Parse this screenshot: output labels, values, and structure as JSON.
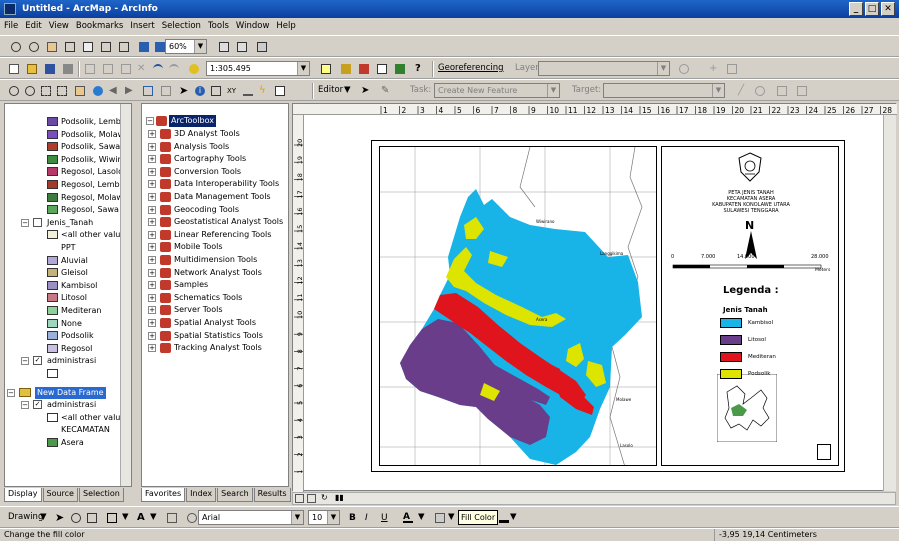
{
  "window": {
    "title": "Untitled - ArcMap - ArcInfo"
  },
  "menu": [
    "File",
    "Edit",
    "View",
    "Bookmarks",
    "Insert",
    "Selection",
    "Tools",
    "Window",
    "Help"
  ],
  "toolbar": {
    "zoom": "60%",
    "scale": "1:305.495",
    "georef": "Georeferencing",
    "layer": "Layer:",
    "editor": "Editor",
    "task": "Task:",
    "task_value": "Create New Feature",
    "target": "Target:"
  },
  "toc": {
    "items_top": [
      {
        "label": "Podsolik, Lembo",
        "color": "#6a4aa5"
      },
      {
        "label": "Podsolik, Molaw",
        "color": "#7b4dc0"
      },
      {
        "label": "Podsolik, Sawa",
        "color": "#b03c2c"
      },
      {
        "label": "Podsolik, Wiwir",
        "color": "#3e8a3e"
      },
      {
        "label": "Regosol, Lasolo",
        "color": "#b43a6a"
      },
      {
        "label": "Regosol, Lembo",
        "color": "#a43b2a"
      },
      {
        "label": "Regosol, Molaw",
        "color": "#3f7a3f"
      },
      {
        "label": "Regosol, Sawa",
        "color": "#5aa65a"
      }
    ],
    "jenis_tanah": {
      "layer": "Jenis_Tanah",
      "all_other": "<all other value:",
      "field": "PPT",
      "classes": [
        {
          "label": "Aluvial",
          "color": "#b0a8d8"
        },
        {
          "label": "Gleisol",
          "color": "#c5b27a"
        },
        {
          "label": "Kambisol",
          "color": "#9a8fc2"
        },
        {
          "label": "Litosol",
          "color": "#c77a86"
        },
        {
          "label": "Mediteran",
          "color": "#8fcf9a"
        },
        {
          "label": "None",
          "color": "#9fd6c0"
        },
        {
          "label": "Podsolik",
          "color": "#9ab0d8"
        },
        {
          "label": "Regosol",
          "color": "#c8c0e0"
        }
      ]
    },
    "administrasi1": "administrasi",
    "frame2": "New Data Frame",
    "administrasi2": "administrasi",
    "all_other2": "<all other value:",
    "kecamatan": "KECAMATAN",
    "asera": "Asera",
    "tabs": [
      "Display",
      "Source",
      "Selection"
    ]
  },
  "toolbox": {
    "root": "ArcToolbox",
    "items": [
      "3D Analyst Tools",
      "Analysis Tools",
      "Cartography Tools",
      "Conversion Tools",
      "Data Interoperability Tools",
      "Data Management Tools",
      "Geocoding Tools",
      "Geostatistical Analyst Tools",
      "Linear Referencing Tools",
      "Mobile Tools",
      "Multidimension Tools",
      "Network Analyst Tools",
      "Samples",
      "Schematics Tools",
      "Server Tools",
      "Spatial Analyst Tools",
      "Spatial Statistics Tools",
      "Tracking Analyst Tools"
    ],
    "tabs": [
      "Favorites",
      "Index",
      "Search",
      "Results"
    ]
  },
  "ruler": [
    "1",
    "2",
    "3",
    "4",
    "5",
    "6",
    "7",
    "8",
    "9",
    "10",
    "11",
    "12",
    "13",
    "14",
    "15",
    "16",
    "17",
    "18",
    "19",
    "20",
    "21",
    "22",
    "23",
    "24",
    "25",
    "26",
    "27",
    "28",
    "29"
  ],
  "vruler": [
    "20",
    "19",
    "18",
    "17",
    "16",
    "15",
    "14",
    "13",
    "12",
    "11",
    "10",
    "9",
    "8",
    "7",
    "6",
    "5",
    "4",
    "3",
    "2",
    "1"
  ],
  "layout": {
    "title_lines": [
      "PETA JENIS TANAH",
      "KECAMATAN ASERA",
      "KABUPATEN KONOLAWE UTARA",
      "SULAWESI TENGGARA"
    ],
    "north": "N",
    "scale_labels": [
      "0",
      "7.000",
      "14.000",
      "28.000"
    ],
    "scale_unit": "Meters",
    "legend_title": "Legenda :",
    "legend_sub": "Jenis Tanah",
    "legend_items": [
      {
        "label": "Kambisol",
        "color": "#18b4e8"
      },
      {
        "label": "Litosol",
        "color": "#6a3d8a"
      },
      {
        "label": "Mediteran",
        "color": "#e0141c"
      },
      {
        "label": "Podsolik",
        "color": "#dde400"
      }
    ],
    "place_labels": [
      "Wiwirano",
      "Langgikima",
      "Asera",
      "Molawe",
      "Lasolo"
    ]
  },
  "drawing": {
    "label": "Drawing",
    "font": "Arial",
    "size": "10",
    "fill": "Fill Color"
  },
  "status": {
    "left": "Change the fill color",
    "coords": "-3,95  19,14 Centimeters"
  }
}
